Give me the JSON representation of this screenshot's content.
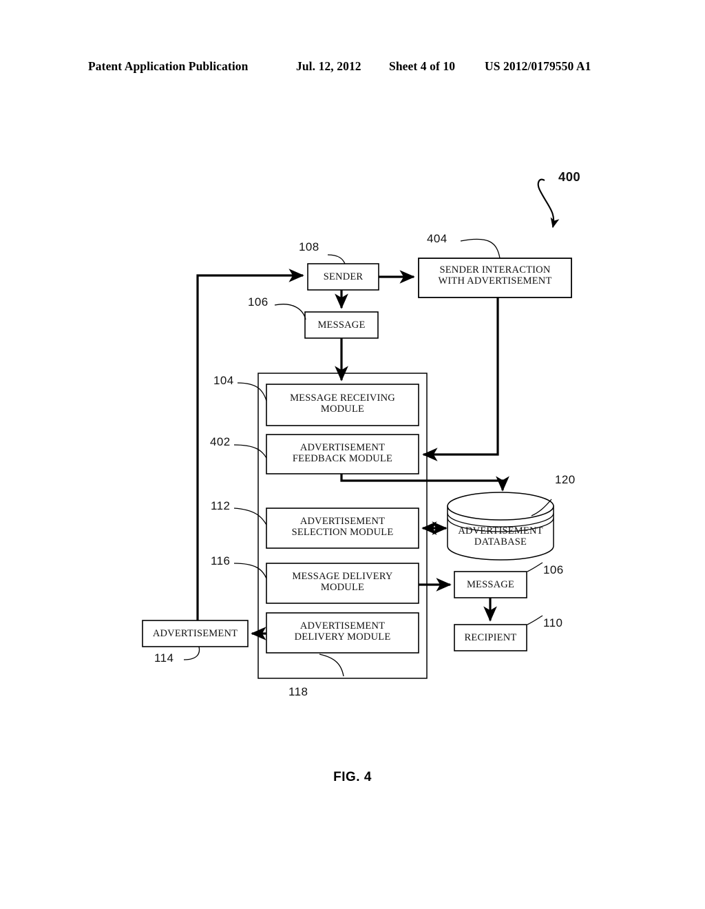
{
  "header": {
    "publication": "Patent Application Publication",
    "date": "Jul. 12, 2012",
    "sheet": "Sheet 4 of 10",
    "patent_number": "US 2012/0179550 A1"
  },
  "figure": {
    "caption": "FIG. 4",
    "figure_ref": "400"
  },
  "nodes": {
    "sender": {
      "label": "SENDER",
      "ref": "108"
    },
    "sender_interaction": {
      "label": "SENDER INTERACTION\nWITH ADVERTISEMENT",
      "ref": "404"
    },
    "message_in": {
      "label": "MESSAGE",
      "ref": "106"
    },
    "message_receiving_module": {
      "label": "MESSAGE RECEIVING\nMODULE",
      "ref": "104"
    },
    "advertisement_feedback_module": {
      "label": "ADVERTISEMENT\nFEEDBACK MODULE",
      "ref": "402"
    },
    "advertisement_selection_module": {
      "label": "ADVERTISEMENT\nSELECTION MODULE",
      "ref": "112"
    },
    "message_delivery_module": {
      "label": "MESSAGE DELIVERY\nMODULE",
      "ref": "116"
    },
    "advertisement_delivery_module": {
      "label": "ADVERTISEMENT\nDELIVERY MODULE",
      "ref": "118"
    },
    "advertisement_database": {
      "label": "ADVERTISEMENT\nDATABASE",
      "ref": "120"
    },
    "message_out": {
      "label": "MESSAGE",
      "ref": "106"
    },
    "recipient": {
      "label": "RECIPIENT",
      "ref": "110"
    },
    "advertisement": {
      "label": "ADVERTISEMENT",
      "ref": "114"
    }
  },
  "colors": {
    "ink": "#000000",
    "paper": "#ffffff"
  }
}
